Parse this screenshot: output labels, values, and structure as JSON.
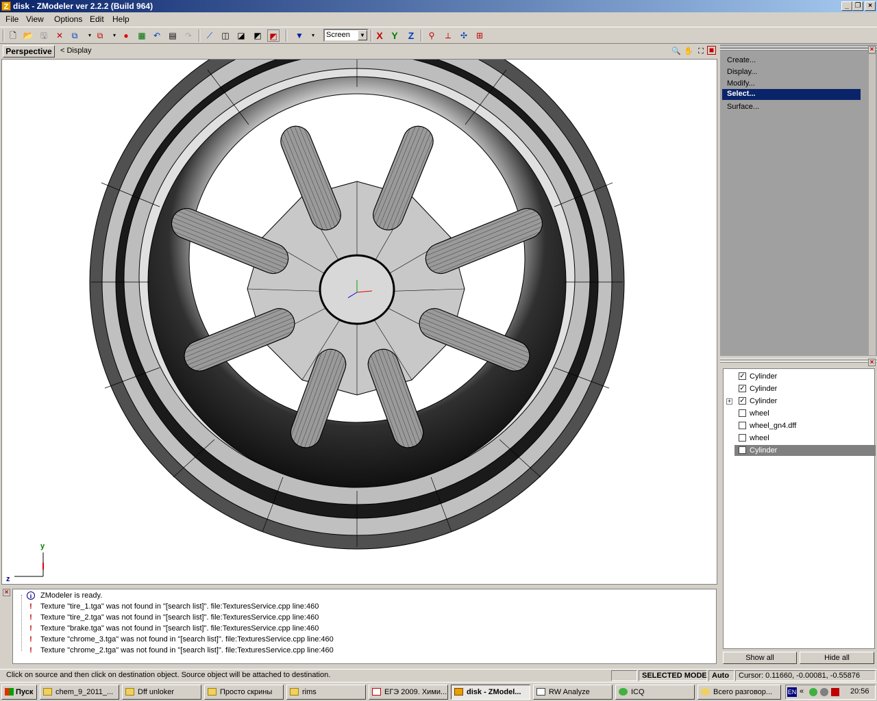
{
  "window": {
    "title": "disk - ZModeler ver 2.2.2 (Build 964)",
    "app_icon": "Z",
    "buttons": [
      "_",
      "❐",
      "×"
    ]
  },
  "menu": [
    "File",
    "View",
    "Options",
    "Edit",
    "Help"
  ],
  "toolbar": {
    "coord_mode": "Screen",
    "axis_x": "X",
    "axis_y": "Y",
    "axis_z": "Z"
  },
  "viewport": {
    "tab_label": "Perspective",
    "display_label": "<  Display",
    "axis_y": "y",
    "axis_z": "z"
  },
  "command_panel": {
    "items": [
      "Create...",
      "Display...",
      "Modify...",
      "Select...",
      "Surface..."
    ],
    "selected_index": 3
  },
  "object_tree": {
    "items": [
      {
        "label": "Cylinder",
        "checked": true,
        "expandable": false
      },
      {
        "label": "Cylinder",
        "checked": true,
        "expandable": false
      },
      {
        "label": "Cylinder",
        "checked": true,
        "expandable": true
      },
      {
        "label": "wheel",
        "checked": false,
        "expandable": false
      },
      {
        "label": "wheel_gn4.dff",
        "checked": false,
        "expandable": false
      },
      {
        "label": "wheel",
        "checked": false,
        "expandable": false
      },
      {
        "label": "Cylinder",
        "checked": true,
        "expandable": false,
        "selected": true
      }
    ],
    "show_all": "Show all",
    "hide_all": "Hide all"
  },
  "log": [
    {
      "type": "info",
      "text": "ZModeler is ready."
    },
    {
      "type": "warning",
      "text": "Texture \"tire_1.tga\" was not found in \"[search list]\". file:TexturesService.cpp line:460"
    },
    {
      "type": "warning",
      "text": "Texture \"tire_2.tga\" was not found in \"[search list]\". file:TexturesService.cpp line:460"
    },
    {
      "type": "warning",
      "text": "Texture \"brake.tga\" was not found in \"[search list]\". file:TexturesService.cpp line:460"
    },
    {
      "type": "warning",
      "text": "Texture \"chrome_3.tga\" was not found in \"[search list]\". file:TexturesService.cpp line:460"
    },
    {
      "type": "warning",
      "text": "Texture \"chrome_2.tga\" was not found in \"[search list]\". file:TexturesService.cpp line:460"
    }
  ],
  "status": {
    "message": "Click on source and then click on destination object. Source object will be attached to destination.",
    "mode": "SELECTED MODE",
    "auto": "Auto",
    "cursor": "Cursor: 0.11660, -0.00081, -0.55876"
  },
  "taskbar": {
    "start": "Пуск",
    "items": [
      {
        "label": "chem_9_2011_...",
        "icon": "folder-icon"
      },
      {
        "label": "Dff unloker",
        "icon": "folder-icon"
      },
      {
        "label": "Просто скрины",
        "icon": "folder-icon"
      },
      {
        "label": "rims",
        "icon": "folder-icon"
      },
      {
        "label": "ЕГЭ 2009. Хими...",
        "icon": "pdf-icon"
      },
      {
        "label": "disk - ZModel...",
        "icon": "zmodeler-icon",
        "active": true
      },
      {
        "label": "RW Analyze",
        "icon": "app-icon"
      },
      {
        "label": "ICQ",
        "icon": "icq-icon"
      },
      {
        "label": "Всего разговор...",
        "icon": "chat-icon"
      }
    ],
    "lang": "EN",
    "clock": "20:56"
  },
  "colors": {
    "title_gradient_start": "#0a246a",
    "title_gradient_end": "#a6caf0",
    "selection": "#0a246a",
    "warning": "#c00000"
  }
}
